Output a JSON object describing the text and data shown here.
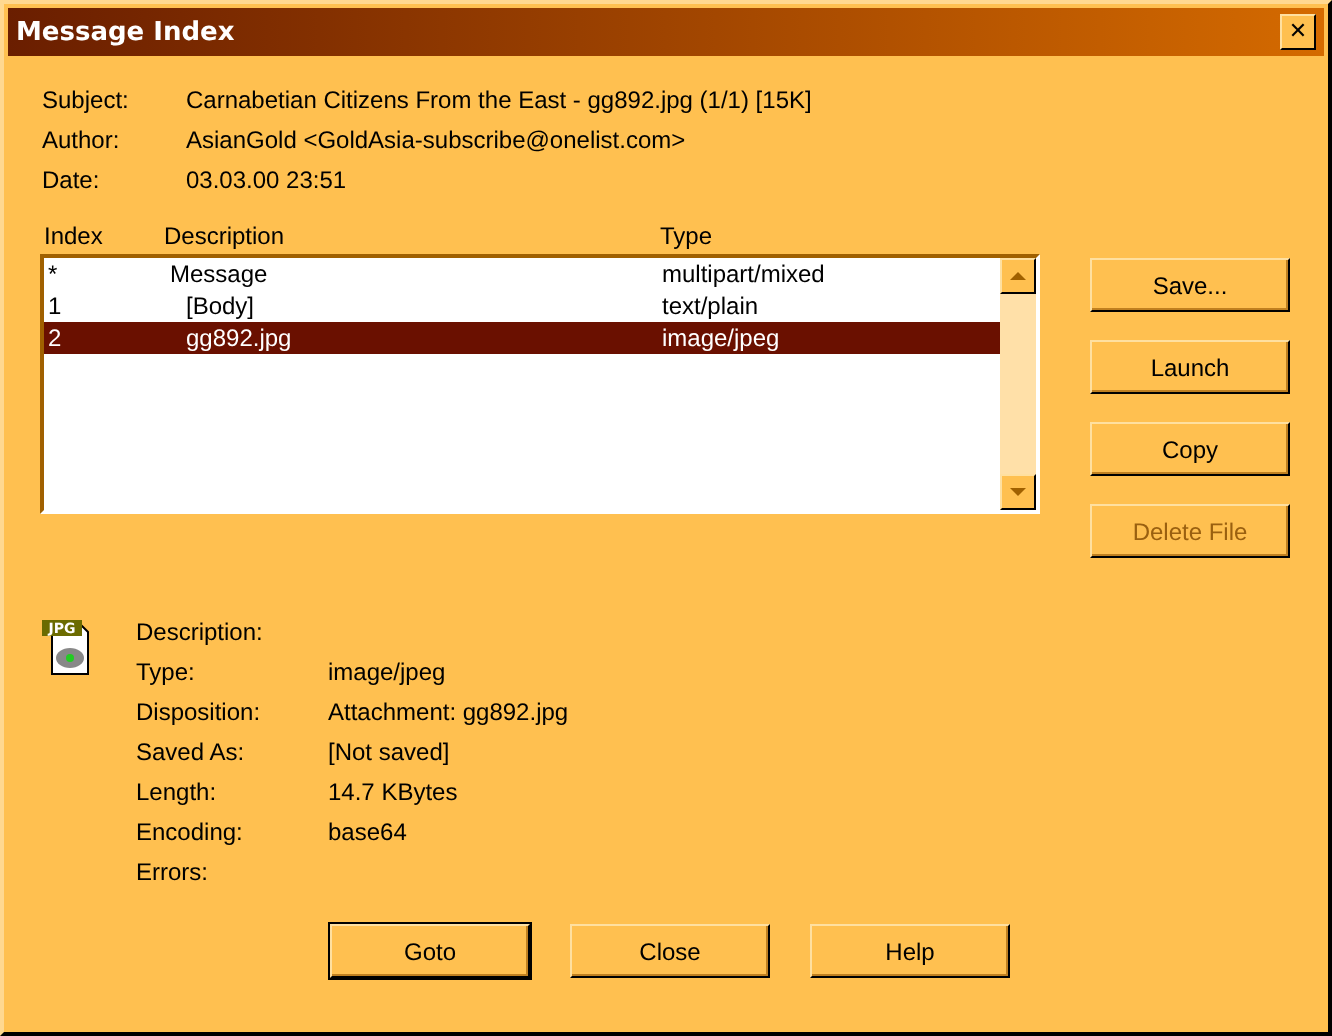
{
  "window": {
    "title": "Message Index",
    "close": "✕"
  },
  "header": [
    {
      "label": "Subject:",
      "value": "Carnabetian Citizens From the East - gg892.jpg (1/1) [15K]"
    },
    {
      "label": "Author:",
      "value": "AsianGold <GoldAsia-subscribe@onelist.com>"
    },
    {
      "label": "Date:",
      "value": "03.03.00 23:51"
    }
  ],
  "table": {
    "columns": [
      "Index",
      "Description",
      "Type"
    ],
    "rows": [
      {
        "index": "*",
        "description": "Message",
        "type": "multipart/mixed",
        "selected": false,
        "children": [
          {
            "index": "1",
            "description": "[Body]",
            "type": "text/plain",
            "selected": false
          },
          {
            "index": "2",
            "description": "gg892.jpg",
            "type": "image/jpeg",
            "selected": true
          }
        ]
      }
    ]
  },
  "side_buttons": [
    {
      "label": "Save...",
      "disabled": false
    },
    {
      "label": "Launch",
      "disabled": false
    },
    {
      "label": "Copy",
      "disabled": false
    },
    {
      "label": "Delete File",
      "disabled": true
    }
  ],
  "file_icon_label": "JPG",
  "details": [
    {
      "label": "Description:"
    },
    {
      "label": "Type:",
      "value": "image/jpeg"
    },
    {
      "label": "Disposition:",
      "value": "Attachment: gg892.jpg"
    },
    {
      "label": "Saved As:",
      "value": "[Not saved]"
    },
    {
      "label": "Length:",
      "value": "14.7 KBytes"
    },
    {
      "label": "Encoding:",
      "value": "base64"
    },
    {
      "label": "Errors:"
    }
  ],
  "buttons": [
    {
      "label": "Goto",
      "default": true
    },
    {
      "label": "Close",
      "default": false
    },
    {
      "label": "Help",
      "default": false
    }
  ]
}
